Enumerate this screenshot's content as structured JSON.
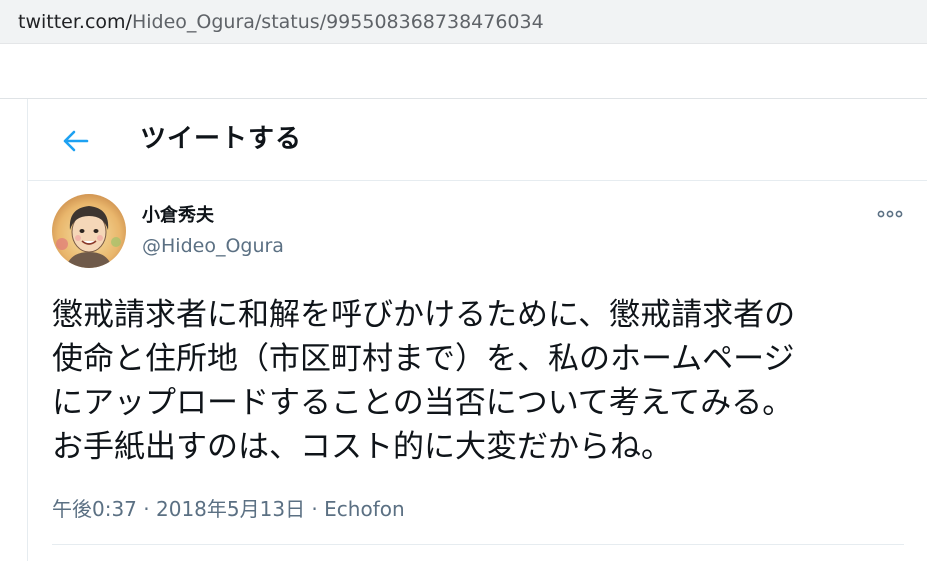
{
  "browser": {
    "url_host": "twitter.com/",
    "url_path": "Hideo_Ogura/status/995508368738476034"
  },
  "header": {
    "back_icon": "arrow-left-icon",
    "title": "ツイートする"
  },
  "tweet": {
    "author": {
      "display_name": "小倉秀夫",
      "handle": "@Hideo_Ogura",
      "avatar_icon": "user-avatar"
    },
    "more_icon": "more-options-icon",
    "text_lines": [
      "懲戒請求者に和解を呼びかけるために、懲戒請求者の",
      "使命と住所地（市区町村まで）を、私のホームページ",
      "にアップロードすることの当否について考えてみる。",
      "お手紙出すのは、コスト的に大変だからね。"
    ],
    "meta": {
      "time": "午後0:37",
      "separator1": " · ",
      "date": "2018年5月13日",
      "separator2": " · ",
      "source": "Echofon"
    }
  },
  "colors": {
    "accent": "#1da1f2",
    "text_primary": "#0f1419",
    "text_secondary": "#5b7083",
    "url_bar_bg": "#f1f3f4"
  }
}
